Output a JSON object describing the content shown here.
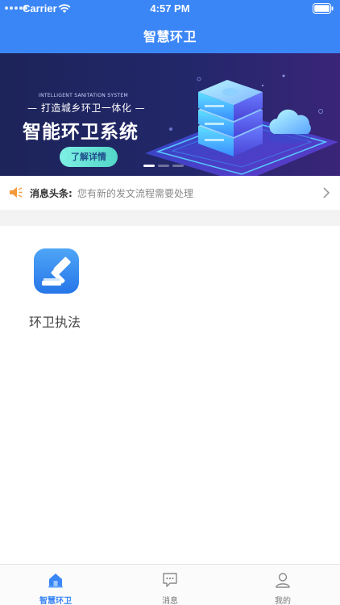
{
  "status_bar": {
    "carrier": "Carrier",
    "time": "4:57 PM"
  },
  "header": {
    "title": "智慧环卫"
  },
  "banner": {
    "subtitle_en": "INTELLIGENT SANITATION SYSTEM",
    "subtitle_cn": "— 打造城乡环卫一体化 —",
    "title": "智能环卫系统",
    "button_label": "了解详情",
    "page_count": 3,
    "active_page": 1
  },
  "news": {
    "label": "消息头条:",
    "text": "您有新的发文流程需要处理"
  },
  "apps": [
    {
      "label": "环卫执法",
      "icon": "gavel-icon"
    }
  ],
  "tabbar": {
    "items": [
      {
        "label": "智慧环卫",
        "icon": "home-icon",
        "active": true
      },
      {
        "label": "消息",
        "icon": "message-icon",
        "active": false
      },
      {
        "label": "我的",
        "icon": "user-icon",
        "active": false
      }
    ],
    "active_color": "#3b86f6"
  },
  "colors": {
    "primary": "#3b86f6",
    "accent_button": "#7ff0e4",
    "speaker": "#f39a3d"
  }
}
